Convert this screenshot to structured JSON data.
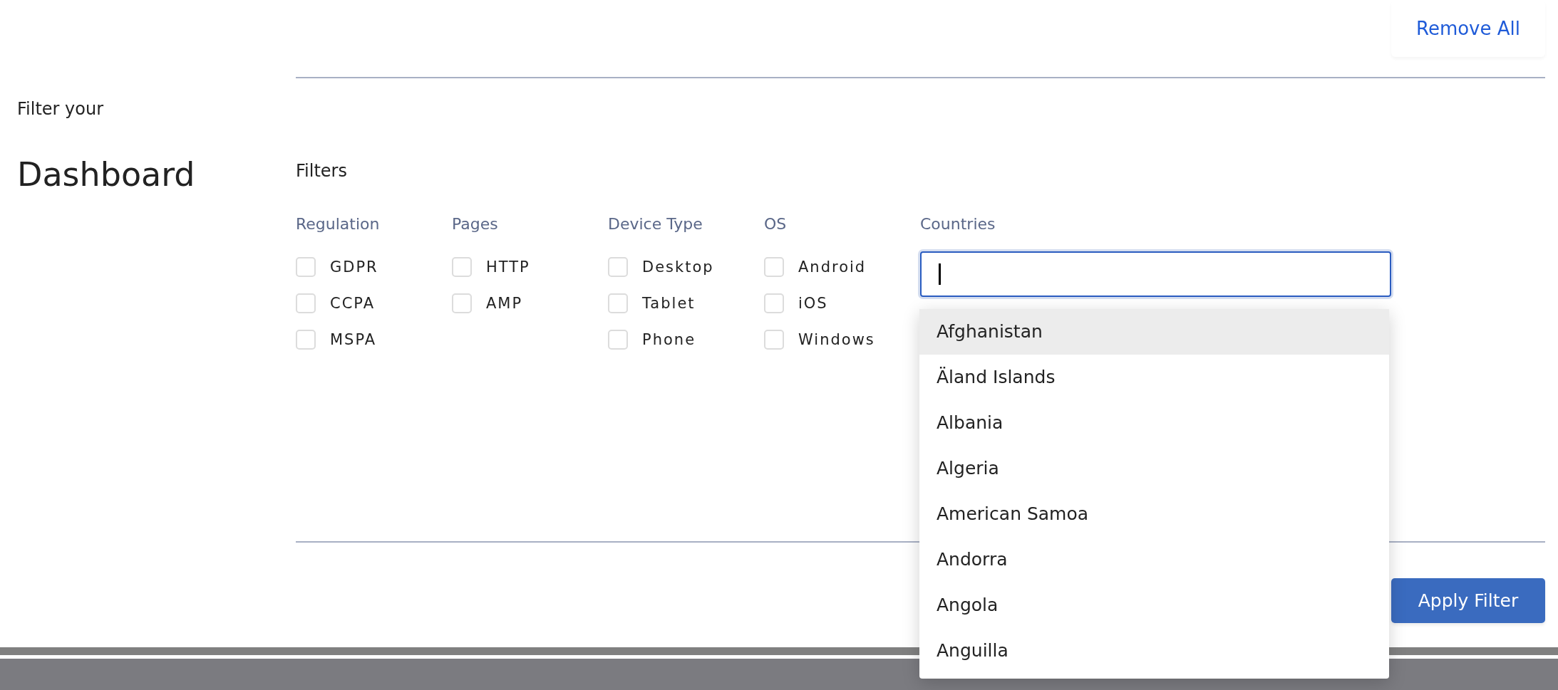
{
  "header": {
    "remove_all": "Remove All"
  },
  "sidebar": {
    "subtitle": "Filter your",
    "title": "Dashboard"
  },
  "filters": {
    "title": "Filters",
    "groups": [
      {
        "label": "Regulation",
        "options": [
          {
            "label": "GDPR",
            "checked": false
          },
          {
            "label": "CCPA",
            "checked": false
          },
          {
            "label": "MSPA",
            "checked": false
          }
        ]
      },
      {
        "label": "Pages",
        "options": [
          {
            "label": "HTTP",
            "checked": false
          },
          {
            "label": "AMP",
            "checked": false
          }
        ]
      },
      {
        "label": "Device Type",
        "options": [
          {
            "label": "Desktop",
            "checked": false
          },
          {
            "label": "Tablet",
            "checked": false
          },
          {
            "label": "Phone",
            "checked": false
          }
        ]
      },
      {
        "label": "OS",
        "options": [
          {
            "label": "Android",
            "checked": false
          },
          {
            "label": "iOS",
            "checked": false
          },
          {
            "label": "Windows",
            "checked": false
          }
        ]
      }
    ],
    "countries": {
      "label": "Countries",
      "focused": true,
      "options": [
        {
          "label": "Afghanistan",
          "selected": true
        },
        {
          "label": "Äland Islands",
          "selected": false
        },
        {
          "label": "Albania",
          "selected": false
        },
        {
          "label": "Algeria",
          "selected": false
        },
        {
          "label": "American Samoa",
          "selected": false
        },
        {
          "label": "Andorra",
          "selected": false
        },
        {
          "label": "Angola",
          "selected": false
        },
        {
          "label": "Anguilla",
          "selected": false
        }
      ]
    }
  },
  "apply_button": "Apply Filter"
}
